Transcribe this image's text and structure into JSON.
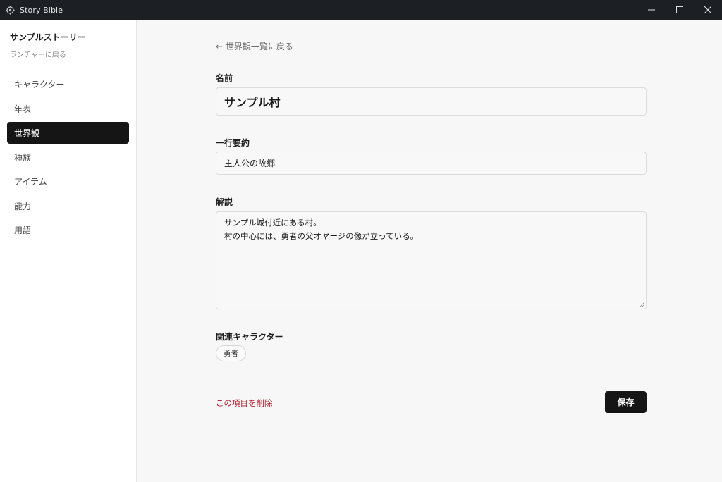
{
  "window": {
    "title": "Story Bible"
  },
  "sidebar": {
    "story_name": "サンプルストーリー",
    "back_label": "ランチャーに戻る",
    "items": [
      {
        "label": "キャラクター"
      },
      {
        "label": "年表"
      },
      {
        "label": "世界観",
        "active": true
      },
      {
        "label": "種族"
      },
      {
        "label": "アイテム"
      },
      {
        "label": "能力"
      },
      {
        "label": "用語"
      }
    ]
  },
  "main": {
    "back_link": "← 世界観一覧に戻る",
    "name_label": "名前",
    "name_value": "サンプル村",
    "summary_label": "一行要約",
    "summary_value": "主人公の故郷",
    "description_label": "解説",
    "description_value": "サンプル城付近にある村。\n村の中心には、勇者の父オヤージの像が立っている。",
    "related_label": "関連キャラクター",
    "related_characters": [
      "勇者"
    ],
    "delete_label": "この項目を削除",
    "save_label": "保存"
  },
  "colors": {
    "titlebar": "#1c1f24",
    "active_nav": "#151515",
    "danger": "#b01e2e"
  }
}
